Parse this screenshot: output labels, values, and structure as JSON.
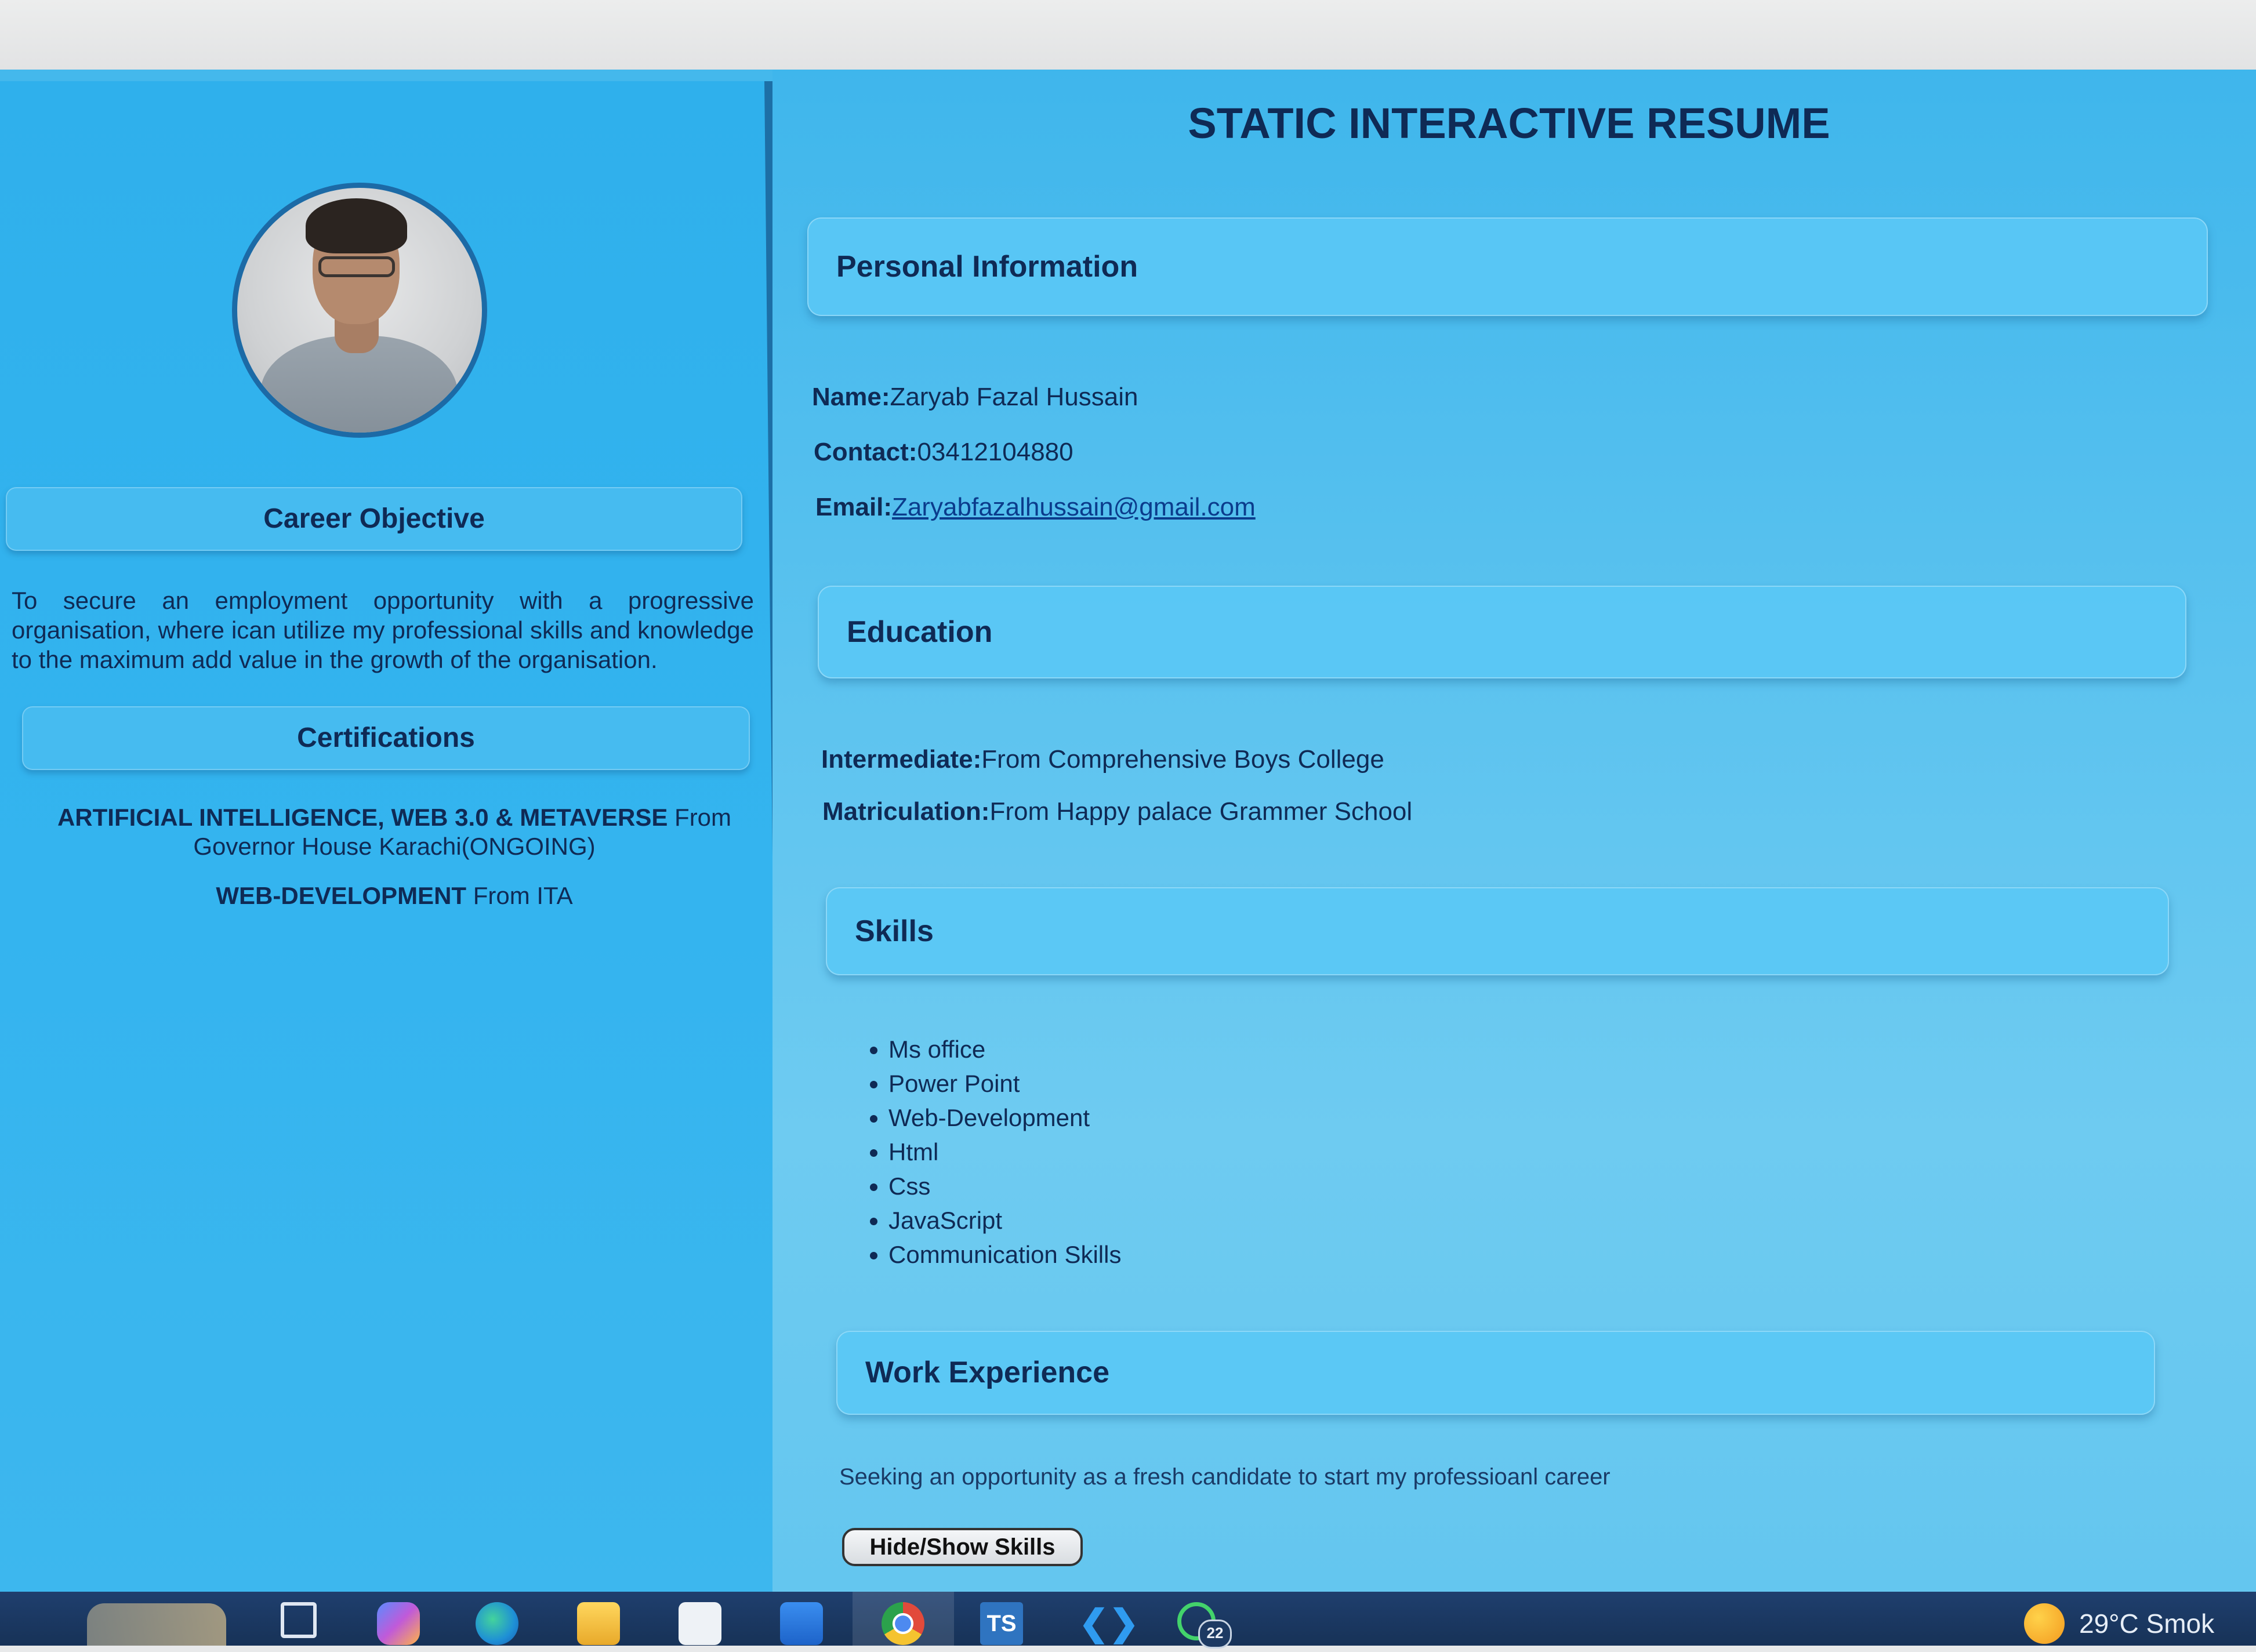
{
  "resume": {
    "title": "STATIC INTERACTIVE RESUME",
    "sidebar": {
      "career_objective_heading": "Career Objective",
      "career_objective_text": "To secure an employment opportunity with a progressive organisation, where ican utilize my professional skills and knowledge to the maximum add value in the growth of the organisation.",
      "certifications_heading": "Certifications",
      "certifications": [
        {
          "name": "ARTIFICIAL INTELLIGENCE, WEB 3.0 & METAVERSE",
          "source": " From Governor House Karachi(ONGOING)"
        },
        {
          "name": "WEB-DEVELOPMENT",
          "source": " From ITA"
        }
      ]
    },
    "personal_info": {
      "heading": "Personal Information",
      "name_label": "Name:",
      "name": "Zaryab Fazal Hussain",
      "contact_label": "Contact:",
      "contact": "03412104880",
      "email_label": "Email:",
      "email": "Zaryabfazalhussain@gmail.com"
    },
    "education": {
      "heading": "Education",
      "items": [
        {
          "label": "Intermediate:",
          "value": "From Comprehensive Boys College"
        },
        {
          "label": "Matriculation:",
          "value": "From Happy palace Grammer School"
        }
      ]
    },
    "skills": {
      "heading": "Skills",
      "items": [
        "Ms office",
        "Power Point",
        "Web-Development",
        "Html",
        "Css",
        "JavaScript",
        "Communication Skills"
      ]
    },
    "work_experience": {
      "heading": "Work Experience",
      "text": "Seeking an opportunity as a fresh candidate to start my professioanl career"
    },
    "toggle_button_label": "Hide/Show Skills"
  },
  "taskbar": {
    "ts_label": "TS",
    "whatsapp_badge": "22",
    "weather": "29°C  Smok"
  },
  "colors": {
    "sidebar_bg": "#34b4ef",
    "main_bg": "#5cc3ef",
    "text": "#0f2a55",
    "divider": "#1d6fa6",
    "taskbar": "#1f3f6e"
  }
}
